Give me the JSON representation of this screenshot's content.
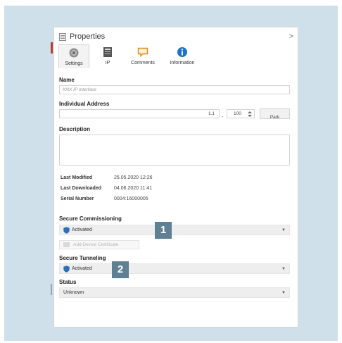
{
  "panel": {
    "title": "Properties",
    "collapse_glyph": ">"
  },
  "tabs": [
    {
      "label": "Settings",
      "icon": "gear-icon"
    },
    {
      "label": "IP",
      "icon": "ip-icon"
    },
    {
      "label": "Comments",
      "icon": "comment-icon"
    },
    {
      "label": "Information",
      "icon": "info-icon"
    }
  ],
  "name": {
    "label": "Name",
    "placeholder": "KNX IP Interface"
  },
  "individual_address": {
    "label": "Individual Address",
    "prefix": "1.1",
    "separator": ".",
    "value": "100",
    "park_label": "Park"
  },
  "description": {
    "label": "Description",
    "value": ""
  },
  "info": [
    {
      "key": "Last Modified",
      "value": "25.05.2020 12:26"
    },
    {
      "key": "Last Downloaded",
      "value": "04.06.2020 11:41"
    },
    {
      "key": "Serial Number",
      "value": "0004:16000005"
    }
  ],
  "secure_commissioning": {
    "label": "Secure Commissioning",
    "value": "Activated",
    "add_certificate_label": "Add Device Certificate"
  },
  "secure_tunneling": {
    "label": "Secure Tunneling",
    "value": "Activated"
  },
  "status": {
    "label": "Status",
    "value": "Unknown"
  },
  "badges": [
    "1",
    "2"
  ],
  "colors": {
    "frame_bg": "#cfe0ea",
    "badge_bg": "#5f7f93",
    "shield_blue": "#2f6fb3",
    "info_blue": "#1e73c8"
  }
}
